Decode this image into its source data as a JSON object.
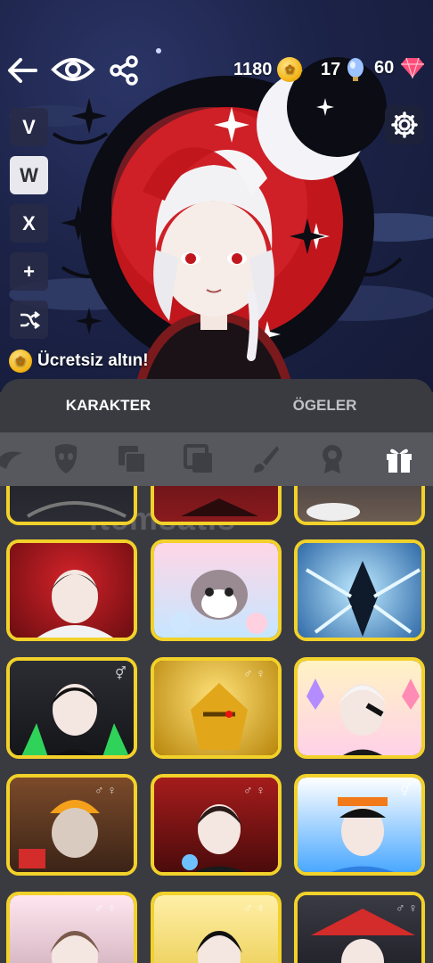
{
  "header": {
    "back_icon": "arrow-left-icon",
    "view_icon": "eye-icon",
    "share_icon": "share-icon",
    "gold": "1180",
    "gems": "17",
    "diamonds": "60",
    "colors": {
      "gold": "#f5b81c",
      "gem": "#8fb6ff",
      "diamond": "#ff4d7a"
    }
  },
  "side_buttons": [
    {
      "label": "V"
    },
    {
      "label": "W"
    },
    {
      "label": "X"
    },
    {
      "label": "+"
    },
    {
      "label": "",
      "icon": "shuffle-icon"
    }
  ],
  "settings_icon": "gear-icon",
  "free_gold": {
    "label": "Ücretsiz altın!"
  },
  "tabs": [
    {
      "label": "KARAKTER",
      "active": true
    },
    {
      "label": "ÖGELER",
      "active": false
    }
  ],
  "categories": [
    "hair-icon",
    "face-mask-icon",
    "layers-icon",
    "square-layers-icon",
    "brush-icon",
    "badge-icon",
    "gift-icon"
  ],
  "watermark": "itemsatis",
  "grid": {
    "columns": 3,
    "border_color": "#f2d12a"
  }
}
